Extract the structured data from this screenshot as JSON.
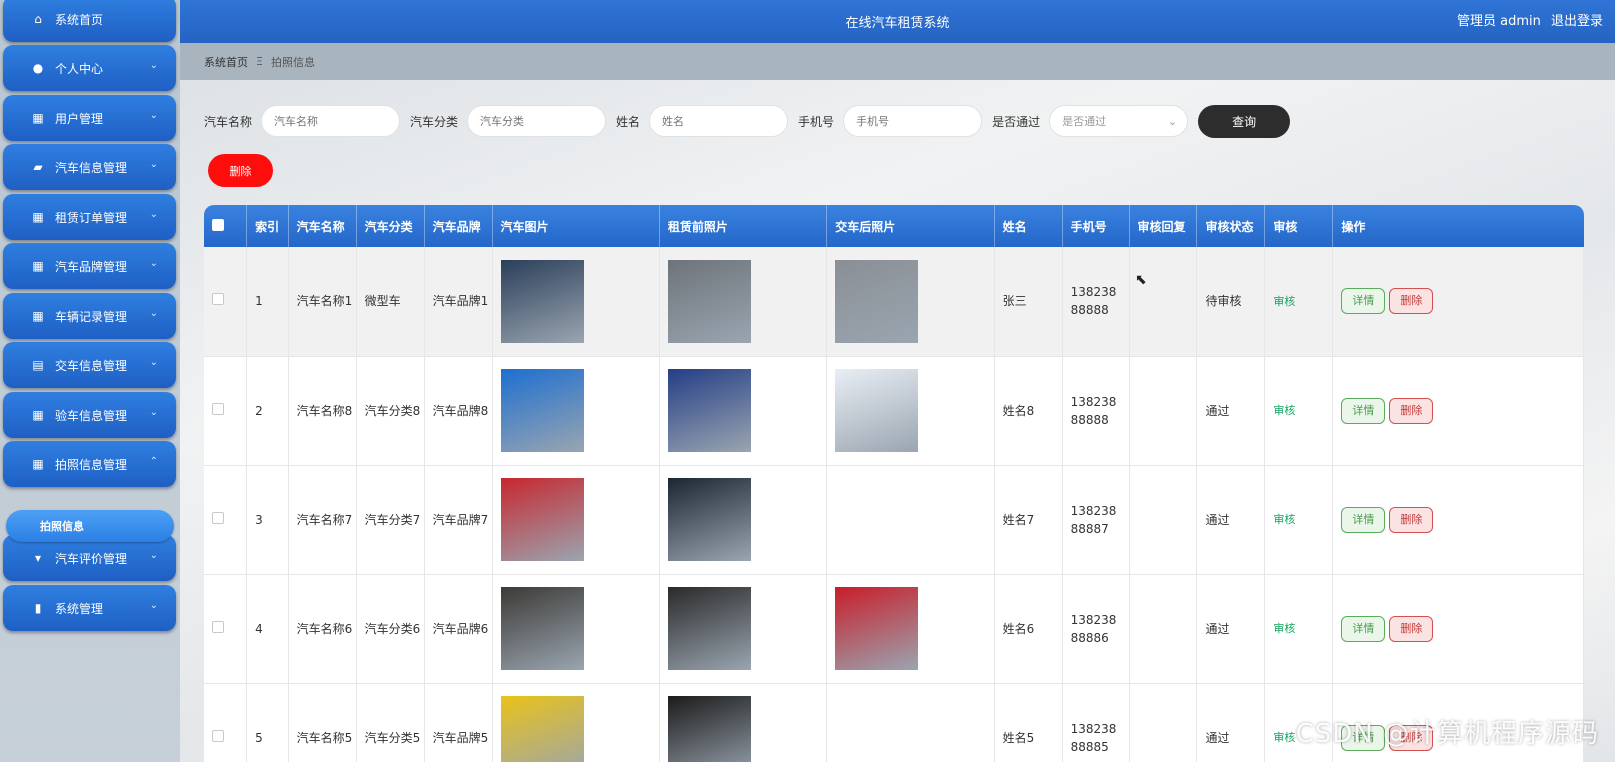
{
  "header": {
    "title": "在线汽车租赁系统",
    "user": "管理员 admin",
    "logout": "退出登录"
  },
  "breadcrumb": {
    "home": "系统首页",
    "sep": "Ξ",
    "current": "拍照信息"
  },
  "sidebar": {
    "items": [
      {
        "label": "系统首页",
        "icon": "home-icon",
        "glyph": "⌂",
        "chev": ""
      },
      {
        "label": "个人中心",
        "icon": "user-icon",
        "glyph": "●",
        "chev": "⌄"
      },
      {
        "label": "用户管理",
        "icon": "grid-icon",
        "glyph": "▦",
        "chev": "⌄"
      },
      {
        "label": "汽车信息管理",
        "icon": "car-icon",
        "glyph": "▰",
        "chev": "⌄"
      },
      {
        "label": "租赁订单管理",
        "icon": "grid-icon",
        "glyph": "▦",
        "chev": "⌄"
      },
      {
        "label": "汽车品牌管理",
        "icon": "grid-icon",
        "glyph": "▦",
        "chev": "⌄"
      },
      {
        "label": "车辆记录管理",
        "icon": "grid-icon",
        "glyph": "▦",
        "chev": "⌄"
      },
      {
        "label": "交车信息管理",
        "icon": "briefcase-icon",
        "glyph": "▤",
        "chev": "⌄"
      },
      {
        "label": "验车信息管理",
        "icon": "grid-icon",
        "glyph": "▦",
        "chev": "⌄"
      },
      {
        "label": "拍照信息管理",
        "icon": "apps-icon",
        "glyph": "▦",
        "chev": "⌃"
      },
      {
        "label": "汽车评价管理",
        "icon": "comment-icon",
        "glyph": "▾",
        "chev": "⌄"
      },
      {
        "label": "系统管理",
        "icon": "chart-icon",
        "glyph": "▮",
        "chev": "⌄"
      }
    ],
    "sub_item": "拍照信息"
  },
  "search": {
    "car_name_label": "汽车名称",
    "car_name_placeholder": "汽车名称",
    "category_label": "汽车分类",
    "category_placeholder": "汽车分类",
    "name_label": "姓名",
    "name_placeholder": "姓名",
    "phone_label": "手机号",
    "phone_placeholder": "手机号",
    "pass_label": "是否通过",
    "pass_placeholder": "是否通过",
    "query_button": "查询"
  },
  "delete_button": "删除",
  "table": {
    "columns": [
      "索引",
      "汽车名称",
      "汽车分类",
      "汽车品牌",
      "汽车图片",
      "租赁前照片",
      "交车后照片",
      "姓名",
      "手机号",
      "审核回复",
      "审核状态",
      "审核",
      "操作"
    ],
    "rows": [
      {
        "index": "1",
        "car_name": "汽车名称1",
        "category": "微型车",
        "brand": "汽车品牌1",
        "name": "张三",
        "phone": "13823888888",
        "reply": "",
        "status": "待审核",
        "audit": "审核",
        "img1": "#2b3f5a",
        "img2": "#6d737a",
        "img3": "#8a8f95"
      },
      {
        "index": "2",
        "car_name": "汽车名称8",
        "category": "汽车分类8",
        "brand": "汽车品牌8",
        "name": "姓名8",
        "phone": "13823888888",
        "reply": "",
        "status": "通过",
        "audit": "审核",
        "img1": "#1d6fd0",
        "img2": "#243e86",
        "img3": "#e9eef5"
      },
      {
        "index": "3",
        "car_name": "汽车名称7",
        "category": "汽车分类7",
        "brand": "汽车品牌7",
        "name": "姓名7",
        "phone": "13823888887",
        "reply": "",
        "status": "通过",
        "audit": "审核",
        "img1": "#c7272f",
        "img2": "#1b2633",
        "img3": ""
      },
      {
        "index": "4",
        "car_name": "汽车名称6",
        "category": "汽车分类6",
        "brand": "汽车品牌6",
        "name": "姓名6",
        "phone": "13823888886",
        "reply": "",
        "status": "通过",
        "audit": "审核",
        "img1": "#3c3a36",
        "img2": "#2a2a2a",
        "img3": "#c81e2a"
      },
      {
        "index": "5",
        "car_name": "汽车名称5",
        "category": "汽车分类5",
        "brand": "汽车品牌5",
        "name": "姓名5",
        "phone": "13823888885",
        "reply": "",
        "status": "通过",
        "audit": "审核",
        "img1": "#e9c21a",
        "img2": "#1b1b1b",
        "img3": ""
      }
    ],
    "detail_button": "详情",
    "delete_button": "删除"
  },
  "watermark": "CSDN @计算机程序源码"
}
